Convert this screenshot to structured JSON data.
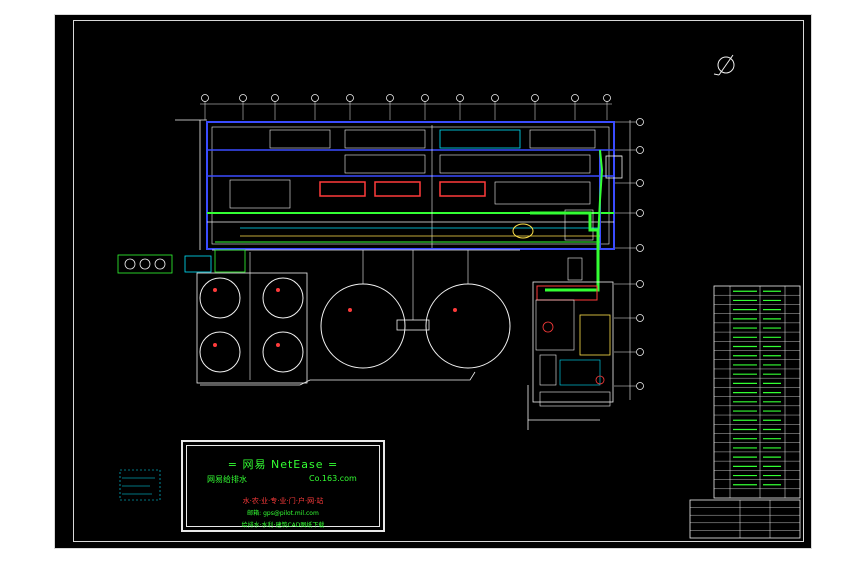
{
  "colors": {
    "page_bg": "#ffffff",
    "drawing_bg": "#000000",
    "frame": "#d8d8d8",
    "wall": "#3a4cff",
    "pipe": "#33ff33",
    "cyan": "#00e5ff",
    "red": "#ff3b3b",
    "yellow": "#ffe24a",
    "magenta": "#ff4dff",
    "white": "#f0f0f0"
  },
  "icons": [
    "north-arrow-icon"
  ],
  "logo": {
    "title": "= 网易 NetEase =",
    "subtitle": "网易给排水",
    "site": "Co.163.com",
    "line1": "水·农·业·专·业·门·户·网·站",
    "line2": "邮箱: gps@pilot.mil.com",
    "line3": "给排水·水利·建筑CAD图纸下载"
  },
  "tanks": [
    {
      "kind": "small"
    },
    {
      "kind": "small"
    },
    {
      "kind": "small"
    },
    {
      "kind": "small"
    },
    {
      "kind": "large"
    },
    {
      "kind": "large"
    }
  ],
  "legend_rows": 23,
  "title_block_rows": 5
}
